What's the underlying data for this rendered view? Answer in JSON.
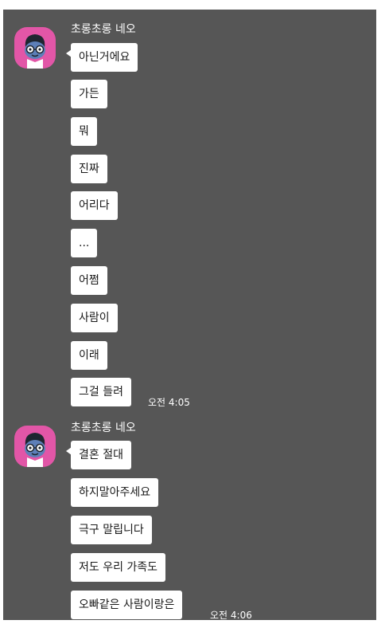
{
  "colors": {
    "chat_background": "#565656",
    "bubble": "#ffffff",
    "avatar_background": "#e256a7"
  },
  "groups": [
    {
      "sender": "초롱초롱 네오",
      "avatar_icon": "neo-profile-icon",
      "messages": [
        "아닌거에요",
        "가든",
        "뭐",
        "진짜",
        "어리다",
        "...",
        "어쩜",
        "사람이",
        "이래",
        "그걸 들려"
      ],
      "time": "오전 4:05"
    },
    {
      "sender": "초롱초롱 네오",
      "avatar_icon": "neo-profile-icon",
      "messages": [
        "결혼 절대",
        "하지말아주세요",
        "극구 말립니다",
        "저도 우리 가족도",
        "오빠같은 사람이랑은"
      ],
      "time": "오전 4:06"
    }
  ]
}
